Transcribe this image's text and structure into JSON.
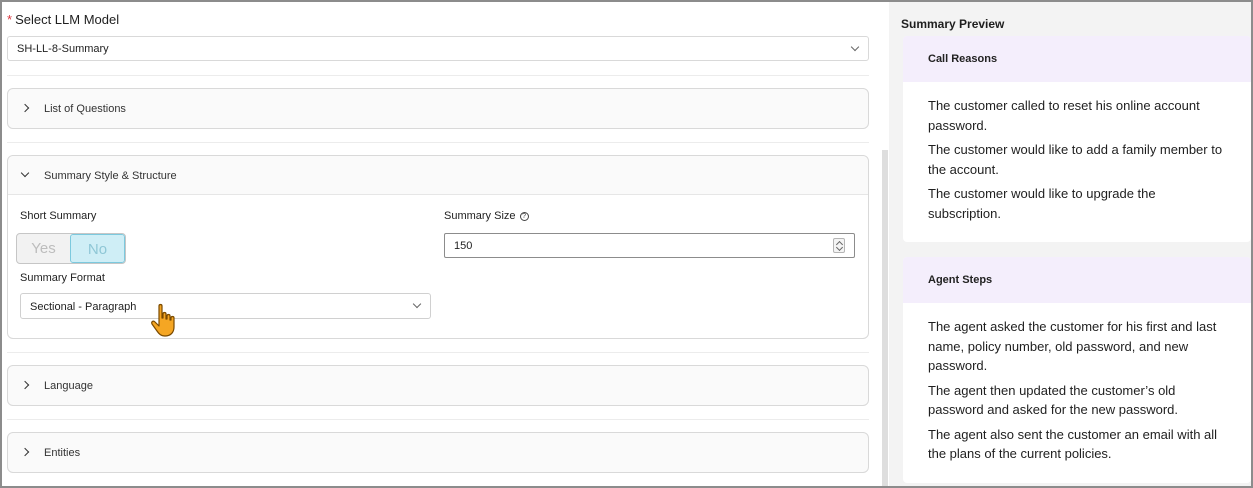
{
  "llm_model": {
    "required_mark": "*",
    "label": "Select LLM Model",
    "selected": "SH-LL-8-Summary"
  },
  "sections": {
    "questions": {
      "title": "List of Questions"
    },
    "style": {
      "title": "Summary Style & Structure",
      "short_summary_label": "Short Summary",
      "toggle_yes": "Yes",
      "toggle_no": "No",
      "toggle_selected": "No",
      "summary_size_label": "Summary Size",
      "summary_size_value": "150",
      "help_icon": "?",
      "summary_format_label": "Summary Format",
      "summary_format_value": "Sectional - Paragraph"
    },
    "language": {
      "title": "Language"
    },
    "entities": {
      "title": "Entities"
    }
  },
  "preview": {
    "title": "Summary Preview",
    "call_reasons": {
      "title": "Call Reasons",
      "items": [
        "The customer called to reset his online account password.",
        "The customer would like to add a family member to the account.",
        "The customer would like to upgrade the subscription."
      ]
    },
    "agent_steps": {
      "title": "Agent Steps",
      "items": [
        "The agent asked the customer for his first and last name, policy number, old password, and new password.",
        "The agent then updated the customer’s old password and asked for the new password.",
        "The agent also sent the customer an email with all the plans of the current policies."
      ]
    }
  },
  "colors": {
    "required": "#d9363e",
    "toggle_active_bg": "#cfeef6",
    "card_header_bg": "#f4eefc",
    "cursor": "#f5a623"
  },
  "icons": [
    "chevron-down-icon",
    "chevron-right-icon",
    "help-circle-icon",
    "spinner-icon",
    "hand-pointer-cursor"
  ]
}
